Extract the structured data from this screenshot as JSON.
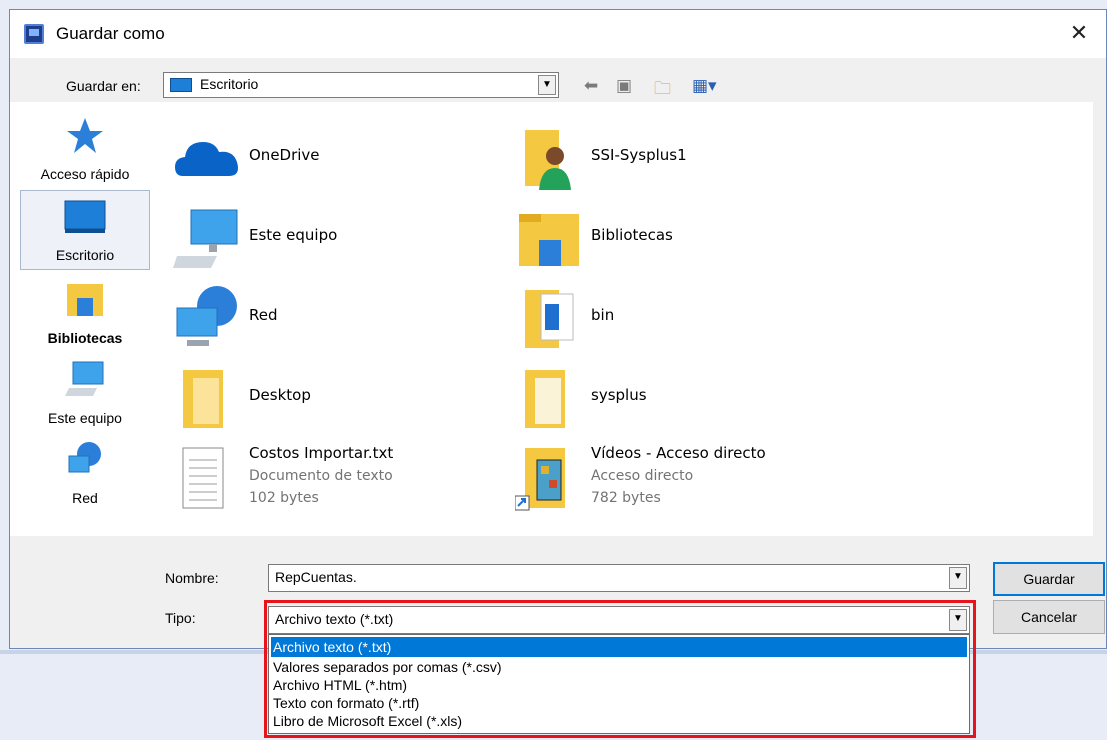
{
  "window": {
    "title": "Guardar como",
    "close_glyph": "✕"
  },
  "location": {
    "label": "Guardar en:",
    "value": "Escritorio"
  },
  "toolbar": {
    "back_icon": "back-arrow-icon",
    "up_icon": "up-folder-icon",
    "new_folder_icon": "new-folder-icon",
    "view_icon": "view-menu-icon"
  },
  "places": [
    {
      "label": "Acceso rápido",
      "icon": "star-icon"
    },
    {
      "label": "Escritorio",
      "icon": "desktop-icon"
    },
    {
      "label": "Bibliotecas",
      "icon": "libraries-icon"
    },
    {
      "label": "Este equipo",
      "icon": "computer-icon"
    },
    {
      "label": "Red",
      "icon": "network-icon"
    }
  ],
  "files": [
    {
      "name": "OneDrive",
      "icon": "cloud-icon"
    },
    {
      "name": "SSI-Sysplus1",
      "icon": "user-folder-icon"
    },
    {
      "name": "Este equipo",
      "icon": "computer-icon"
    },
    {
      "name": "Bibliotecas",
      "icon": "libraries-icon"
    },
    {
      "name": "Red",
      "icon": "network-icon"
    },
    {
      "name": "bin",
      "icon": "folder-icon"
    },
    {
      "name": "Desktop",
      "icon": "folder-icon"
    },
    {
      "name": "sysplus",
      "icon": "folder-icon"
    },
    {
      "name": "Costos Importar.txt",
      "type": "Documento de texto",
      "size": "102 bytes",
      "icon": "text-file-icon"
    },
    {
      "name": "Vídeos - Acceso directo",
      "type": "Acceso directo",
      "size": "782 bytes",
      "icon": "video-shortcut-icon"
    }
  ],
  "filename": {
    "label": "Nombre:",
    "value": "RepCuentas."
  },
  "filetype": {
    "label": "Tipo:",
    "value": "Archivo texto (*.txt)",
    "options": [
      "Archivo texto (*.txt)",
      "Valores separados por comas (*.csv)",
      "Archivo HTML (*.htm)",
      "Texto con formato (*.rtf)",
      "Libro de Microsoft Excel (*.xls)"
    ]
  },
  "buttons": {
    "save": "Guardar",
    "cancel": "Cancelar"
  },
  "colors": {
    "selection": "#0078d7",
    "highlight_box": "#e8141c"
  }
}
